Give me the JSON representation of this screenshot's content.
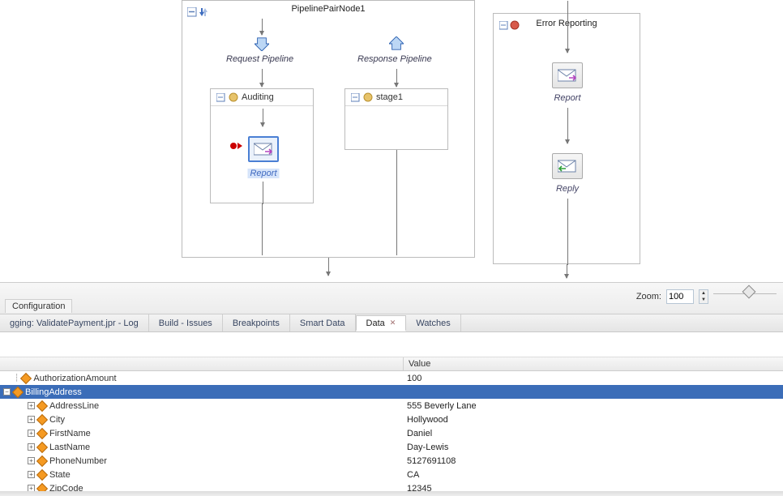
{
  "pipeline_pair_node": {
    "title": "PipelinePairNode1",
    "request_label": "Request Pipeline",
    "response_label": "Response Pipeline",
    "auditing_stage_label": "Auditing",
    "stage1_label": "stage1",
    "report_action_label": "Report"
  },
  "error_node": {
    "title": "Error Reporting",
    "report_label": "Report",
    "reply_label": "Reply"
  },
  "zoom": {
    "label": "Zoom:",
    "value": "100"
  },
  "conf_tab_label": "Configuration",
  "tabs": {
    "log": "gging: ValidatePayment.jpr - Log",
    "build": "Build - Issues",
    "breakpoints": "Breakpoints",
    "smart_data": "Smart Data",
    "data": "Data",
    "watches": "Watches"
  },
  "grid_headers": {
    "name": " ",
    "value": "Value"
  },
  "rows": {
    "auth_amount_name": "AuthorizationAmount",
    "auth_amount_value": "100",
    "billing_name": "BillingAddress",
    "address_line_name": "AddressLine",
    "address_line_value": "555 Beverly Lane",
    "city_name": "City",
    "city_value": "Hollywood",
    "first_name_name": "FirstName",
    "first_name_value": "Daniel",
    "last_name_name": "LastName",
    "last_name_value": "Day-Lewis",
    "phone_name": "PhoneNumber",
    "phone_value": "5127691108",
    "state_name": "State",
    "state_value": "CA",
    "zip_name": "ZipCode",
    "zip_value": "12345"
  }
}
